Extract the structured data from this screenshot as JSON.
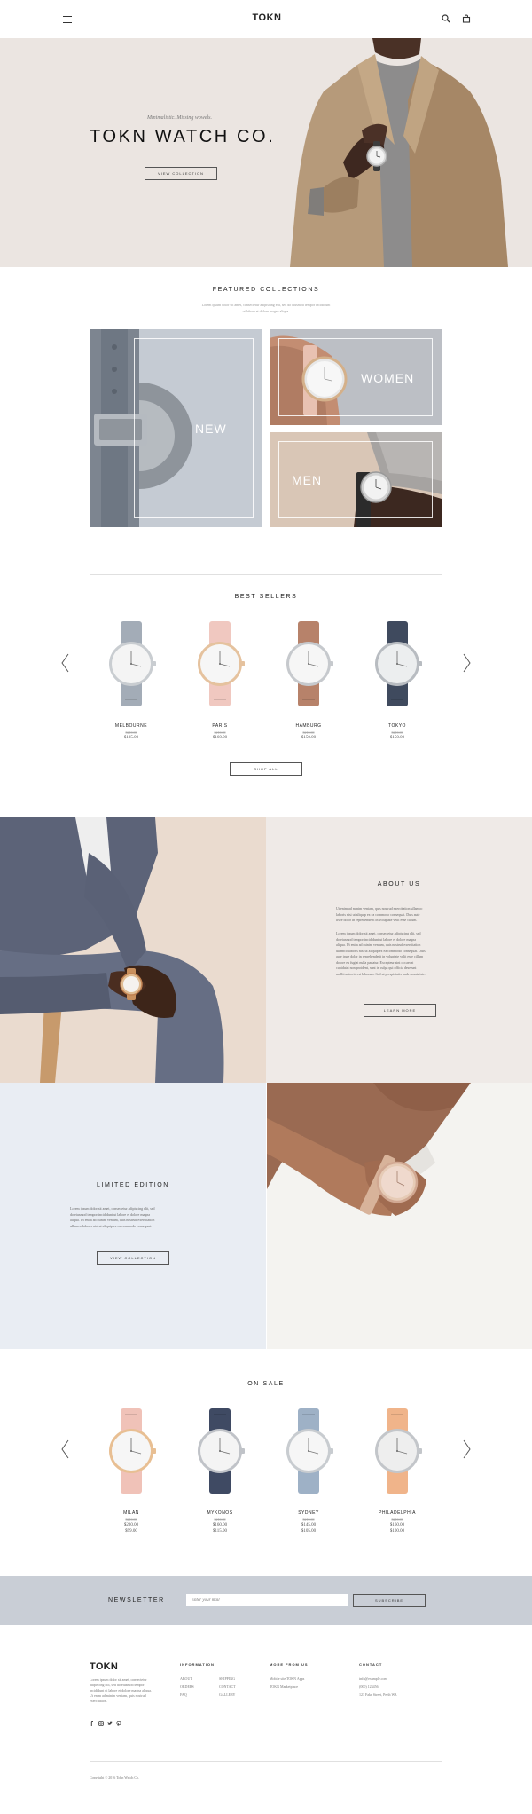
{
  "header": {
    "logo": "TOKN",
    "menu_icon": "hamburger-menu-icon",
    "search_icon": "search-icon",
    "cart_icon": "shopping-bag-icon"
  },
  "hero": {
    "tagline": "Minimalistic. Missing wowels.",
    "title": "TOKN WATCH CO.",
    "button": "VIEW COLLECTION"
  },
  "featured": {
    "title": "FEATURED COLLECTIONS",
    "subtitle_1": "Lorem ipsum dolor sit amet, consectetur adipiscing elit, sed do eiusmod tempor incididunt",
    "subtitle_2": "ut labore et dolore magna aliqua.",
    "tiles": [
      {
        "label": "NEW"
      },
      {
        "label": "WOMEN"
      },
      {
        "label": "MEN"
      }
    ]
  },
  "best_sellers": {
    "title": "BEST SELLERS",
    "products": [
      {
        "name": "MELBOURNE",
        "old_price": "$210.00",
        "price": "$135.00",
        "strap": "#a3acb7",
        "face": "#f4f4f4",
        "case": "#c9cdd1"
      },
      {
        "name": "PARIS",
        "old_price": "$210.00",
        "price": "$160.00",
        "strap": "#f0c8c0",
        "face": "#f6f6f6",
        "case": "#e5c29e"
      },
      {
        "name": "HAMBURG",
        "old_price": "$210.00",
        "price": "$150.00",
        "strap": "#b7826a",
        "face": "#f6f6f6",
        "case": "#c6c9cd"
      },
      {
        "name": "TOKYO",
        "old_price": "$210.00",
        "price": "$150.00",
        "strap": "#3f4a5e",
        "face": "#eceeef",
        "case": "#b8bcc1"
      }
    ],
    "button": "SHOP ALL"
  },
  "about": {
    "title": "ABOUT US",
    "para_1": [
      "Ut enim ad minim veniam, quis nostrud exercitation ullamco",
      "laboris nisi ut aliquip ex ea commodo consequat. Duis aute",
      "irure dolor in reprehenderit in voluptate velit esse cillum."
    ],
    "para_2": [
      "Lorem ipsum dolor sit amet, consectetur adipiscing elit, sed",
      "do eiusmod tempor incididunt ut labore et dolore magna",
      "aliqua. Ut enim ad minim veniam, quis nostrud exercitation",
      "ullamco laboris nisi ut aliquip ex ea commodo consequat. Duis",
      "aute irure dolor in reprehenderit in voluptate velit esse cillum",
      "dolore eu fugiat nulla pariatur. Excepteur sint occaecat",
      "cupidatat non proident, sunt in culpa qui officia deserunt",
      "mollit anim id est laborum. Sed ut perspiciatis unde omnis iste."
    ],
    "button": "LEARN MORE"
  },
  "limited": {
    "title": "LIMITED EDITION",
    "para": [
      "Lorem ipsum dolor sit amet, consectetur adipiscing elit, sed",
      "do eiusmod tempor incididunt ut labore et dolore magna",
      "aliqua. Ut enim ad minim veniam, quis nostrud exercitation",
      "ullamco laboris nisi ut aliquip ex ea commodo consequat."
    ],
    "button": "VIEW COLLECTION"
  },
  "on_sale": {
    "title": "ON SALE",
    "products": [
      {
        "name": "MILAN",
        "old_price": "$210.00",
        "price_1": "$230.00",
        "price_2": "$99.00",
        "strap": "#f0c2b8",
        "face": "#f6f6f6",
        "case": "#e8bf93"
      },
      {
        "name": "MYKONOS",
        "old_price": "$210.00",
        "price_1": "$160.00",
        "price_2": "$115.00",
        "strap": "#3f4a63",
        "face": "#f4f4f4",
        "case": "#c0c3c8"
      },
      {
        "name": "SYDNEY",
        "old_price": "$210.00",
        "price_1": "$145.00",
        "price_2": "$105.00",
        "strap": "#9eb1c6",
        "face": "#f6f6f6",
        "case": "#c8ccd0"
      },
      {
        "name": "PHILADELPHIA",
        "old_price": "$210.00",
        "price_1": "$160.00",
        "price_2": "$100.00",
        "strap": "#f0b48a",
        "face": "#eeeeee",
        "case": "#c3c6ca"
      }
    ]
  },
  "newsletter": {
    "label": "NEWSLETTER",
    "placeholder": "Enter your mail",
    "button": "SUBSCRIBE"
  },
  "footer": {
    "logo": "TOKN",
    "about_lines": [
      "Lorem ipsum dolor sit amet, consectetur",
      "adipiscing elit, sed do eiusmod tempor",
      "incididunt ut labore et dolore magna aliqua.",
      "Ut enim ad minim veniam, quis nostrud",
      "exercitation."
    ],
    "columns": [
      {
        "title": "INFORMATION",
        "col_a": [
          "ABOUT",
          "ORDERS",
          "FAQ"
        ],
        "col_b": [
          "SHIPPING",
          "CONTACT",
          "GALLERY"
        ]
      },
      {
        "title": "MORE FROM US",
        "col_a": [
          "Mobile site TOKN Apps",
          "TOKN Marketplace"
        ],
        "col_b": []
      },
      {
        "title": "CONTACT",
        "col_a": [
          "info@example.com",
          "(000) 123456",
          "123 Fake Street, Perth WA"
        ],
        "col_b": []
      }
    ],
    "social": [
      "facebook-icon",
      "instagram-icon",
      "twitter-icon",
      "pinterest-icon"
    ],
    "copyright": "Copyright © 2016 Tokn Watch Co."
  },
  "colors": {
    "hero_bg": "#ebe5e1",
    "about_bg": "#efeae7",
    "limited_bg": "#e9edf3",
    "newsletter_bg": "#c9ced6",
    "tile_new_bg": "#c5cbd3",
    "tile_women_bg": "#bcbfc5",
    "tile_men_bg": "#d9c6b6"
  }
}
